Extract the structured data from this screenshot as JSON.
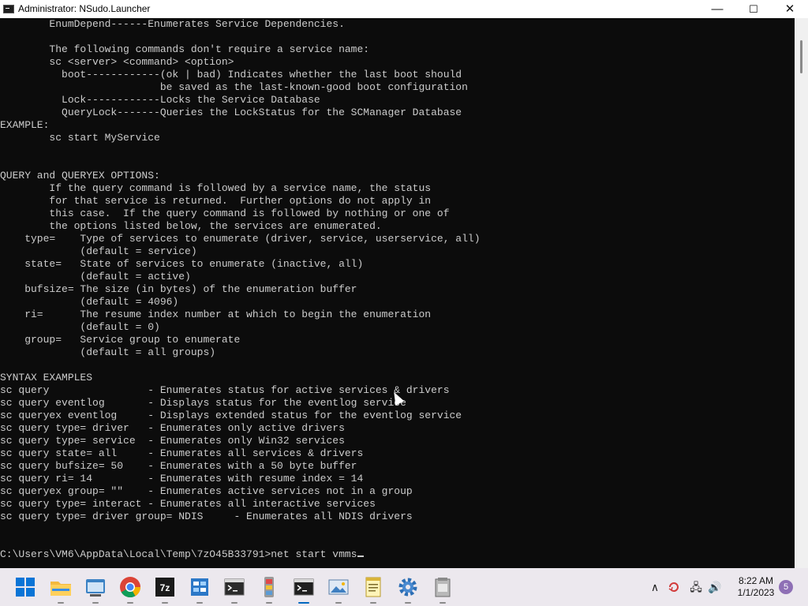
{
  "window": {
    "title": "Administrator: NSudo.Launcher",
    "controls": {
      "minimize": "—",
      "maximize": "☐",
      "close": "✕"
    }
  },
  "console": {
    "lines": [
      "        EnumDepend------Enumerates Service Dependencies.",
      "",
      "        The following commands don't require a service name:",
      "        sc <server> <command> <option>",
      "          boot------------(ok | bad) Indicates whether the last boot should",
      "                          be saved as the last-known-good boot configuration",
      "          Lock------------Locks the Service Database",
      "          QueryLock-------Queries the LockStatus for the SCManager Database",
      "EXAMPLE:",
      "        sc start MyService",
      "",
      "",
      "QUERY and QUERYEX OPTIONS:",
      "        If the query command is followed by a service name, the status",
      "        for that service is returned.  Further options do not apply in",
      "        this case.  If the query command is followed by nothing or one of",
      "        the options listed below, the services are enumerated.",
      "    type=    Type of services to enumerate (driver, service, userservice, all)",
      "             (default = service)",
      "    state=   State of services to enumerate (inactive, all)",
      "             (default = active)",
      "    bufsize= The size (in bytes) of the enumeration buffer",
      "             (default = 4096)",
      "    ri=      The resume index number at which to begin the enumeration",
      "             (default = 0)",
      "    group=   Service group to enumerate",
      "             (default = all groups)",
      "",
      "SYNTAX EXAMPLES",
      "sc query                - Enumerates status for active services & drivers",
      "sc query eventlog       - Displays status for the eventlog service",
      "sc queryex eventlog     - Displays extended status for the eventlog service",
      "sc query type= driver   - Enumerates only active drivers",
      "sc query type= service  - Enumerates only Win32 services",
      "sc query state= all     - Enumerates all services & drivers",
      "sc query bufsize= 50    - Enumerates with a 50 byte buffer",
      "sc query ri= 14         - Enumerates with resume index = 14",
      "sc queryex group= \"\"    - Enumerates active services not in a group",
      "sc query type= interact - Enumerates all interactive services",
      "sc query type= driver group= NDIS     - Enumerates all NDIS drivers",
      "",
      "",
      "C:\\Users\\VM6\\AppData\\Local\\Temp\\7zO45B33791>net start vmms"
    ]
  },
  "taskbar": {
    "icons": [
      {
        "name": "start-icon",
        "running": false
      },
      {
        "name": "file-explorer-icon",
        "running": true
      },
      {
        "name": "task-view-icon",
        "running": true
      },
      {
        "name": "chrome-icon",
        "running": true
      },
      {
        "name": "7zip-icon",
        "running": true
      },
      {
        "name": "registry-editor-icon",
        "running": true
      },
      {
        "name": "terminal-icon",
        "running": true
      },
      {
        "name": "nsudo-icon",
        "running": true
      },
      {
        "name": "console-window-icon",
        "running": true,
        "active": true
      },
      {
        "name": "photo-viewer-icon",
        "running": true
      },
      {
        "name": "notepad-icon",
        "running": true
      },
      {
        "name": "settings-gear-icon",
        "running": true
      },
      {
        "name": "archive-tool-icon",
        "running": true
      }
    ],
    "tray": {
      "chevron": "∧",
      "network": "🖧",
      "volume": "🔊",
      "time": "8:22 AM",
      "date": "1/1/2023",
      "notification_count": "5"
    }
  }
}
